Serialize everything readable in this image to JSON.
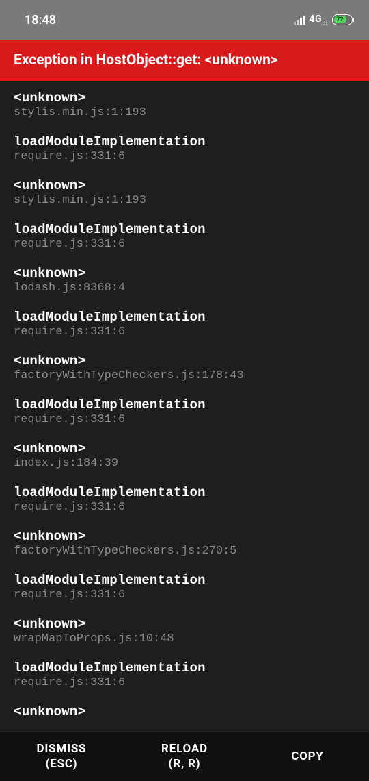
{
  "statusbar": {
    "time": "18:48",
    "network": "4G",
    "network_suffix": ".ıl",
    "battery_pct": "72"
  },
  "error": {
    "title": "Exception in HostObject::get: <unknown>"
  },
  "stack": [
    {
      "fn": "<unknown>",
      "loc": "stylis.min.js:1:193"
    },
    {
      "fn": "loadModuleImplementation",
      "loc": "require.js:331:6"
    },
    {
      "fn": "<unknown>",
      "loc": "stylis.min.js:1:193"
    },
    {
      "fn": "loadModuleImplementation",
      "loc": "require.js:331:6"
    },
    {
      "fn": "<unknown>",
      "loc": "lodash.js:8368:4"
    },
    {
      "fn": "loadModuleImplementation",
      "loc": "require.js:331:6"
    },
    {
      "fn": "<unknown>",
      "loc": "factoryWithTypeCheckers.js:178:43"
    },
    {
      "fn": "loadModuleImplementation",
      "loc": "require.js:331:6"
    },
    {
      "fn": "<unknown>",
      "loc": "index.js:184:39"
    },
    {
      "fn": "loadModuleImplementation",
      "loc": "require.js:331:6"
    },
    {
      "fn": "<unknown>",
      "loc": "factoryWithTypeCheckers.js:270:5"
    },
    {
      "fn": "loadModuleImplementation",
      "loc": "require.js:331:6"
    },
    {
      "fn": "<unknown>",
      "loc": "wrapMapToProps.js:10:48"
    },
    {
      "fn": "loadModuleImplementation",
      "loc": "require.js:331:6"
    },
    {
      "fn": "<unknown>",
      "loc": ""
    }
  ],
  "footer": {
    "dismiss": {
      "label": "DISMISS",
      "sub": "(ESC)"
    },
    "reload": {
      "label": "RELOAD",
      "sub": "(R, R)"
    },
    "copy": {
      "label": "COPY"
    }
  }
}
